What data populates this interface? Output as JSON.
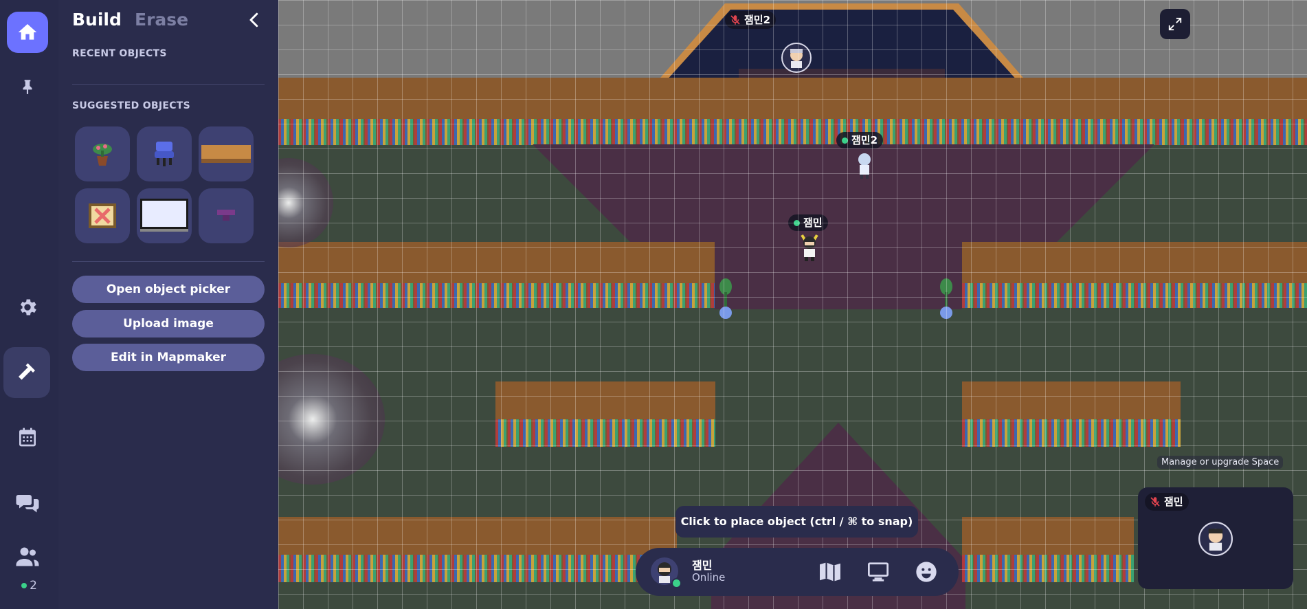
{
  "rail": {
    "items": [
      "home",
      "pin",
      "settings",
      "build",
      "calendar",
      "chat",
      "people"
    ],
    "online_count": "2"
  },
  "panel": {
    "tabs": {
      "build": "Build",
      "erase": "Erase"
    },
    "recent_title": "RECENT OBJECTS",
    "suggested_title": "SUGGESTED OBJECTS",
    "suggested_objects": [
      "potted-plant",
      "blue-chair",
      "wooden-table",
      "framed-picture",
      "whiteboard",
      "purple-block"
    ],
    "buttons": {
      "open_picker": "Open object picker",
      "upload_image": "Upload image",
      "edit_mapmaker": "Edit in Mapmaker"
    }
  },
  "map": {
    "players": [
      {
        "name": "잼민2",
        "status": "muted"
      },
      {
        "name": "잼민2",
        "status": "online"
      },
      {
        "name": "잼민",
        "status": "online"
      }
    ],
    "tooltip": "Click to place object (ctrl / ⌘ to snap)",
    "manage_label": "Manage or upgrade Space"
  },
  "bottom_bar": {
    "name": "잼민",
    "status": "Online",
    "icons": [
      "map-icon",
      "screen-share-icon",
      "emoji-icon"
    ]
  },
  "video_tile": {
    "name": "잼민",
    "status": "muted"
  },
  "colors": {
    "accent": "#6c72ff",
    "panel_bg": "#2a2c4c",
    "rail_bg": "#282a4a",
    "online": "#3bd18a",
    "muted": "#e0444f"
  }
}
